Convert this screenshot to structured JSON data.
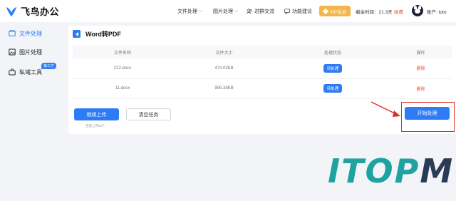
{
  "header": {
    "logo_text": "飞鸟办公",
    "nav": [
      {
        "label": "文件处理",
        "dropdown": true,
        "icon": null
      },
      {
        "label": "图片处理",
        "dropdown": true,
        "icon": null
      },
      {
        "label": "进群交流",
        "dropdown": false,
        "icon": "people-icon"
      },
      {
        "label": "功能建议",
        "dropdown": false,
        "icon": "chat-icon"
      }
    ],
    "vip_label": "VIP会员",
    "remaining": "剩余时间：21.3天",
    "renew_label": "续费",
    "account_label": "账户: toto"
  },
  "sidebar": {
    "items": [
      {
        "label": "文件处理",
        "active": true,
        "icon": "file-icon"
      },
      {
        "label": "图片处理",
        "active": false,
        "icon": "image-icon"
      },
      {
        "label": "私域工具",
        "active": false,
        "icon": "toolbox-icon",
        "badge": "第三方"
      }
    ]
  },
  "main": {
    "title": "Word转PDF",
    "columns": [
      "文件名称",
      "文件大小",
      "处理状态",
      "操作"
    ],
    "rows": [
      {
        "name": "222.docx",
        "size": "474.03KB",
        "status": "待处理",
        "action": "删除"
      },
      {
        "name": "11.docx",
        "size": "995.38KB",
        "status": "待处理",
        "action": "删除"
      }
    ],
    "continue_label": "继续上传",
    "clear_label": "清空任务",
    "hint": "还能上传20个",
    "start_label": "开始处理"
  },
  "watermark": {
    "part1": "ITOP",
    "part2": "M"
  },
  "colors": {
    "accent": "#2d7cf6",
    "danger": "#e9532c",
    "vip": "#f6b54b",
    "annotation": "#e02b2b"
  }
}
